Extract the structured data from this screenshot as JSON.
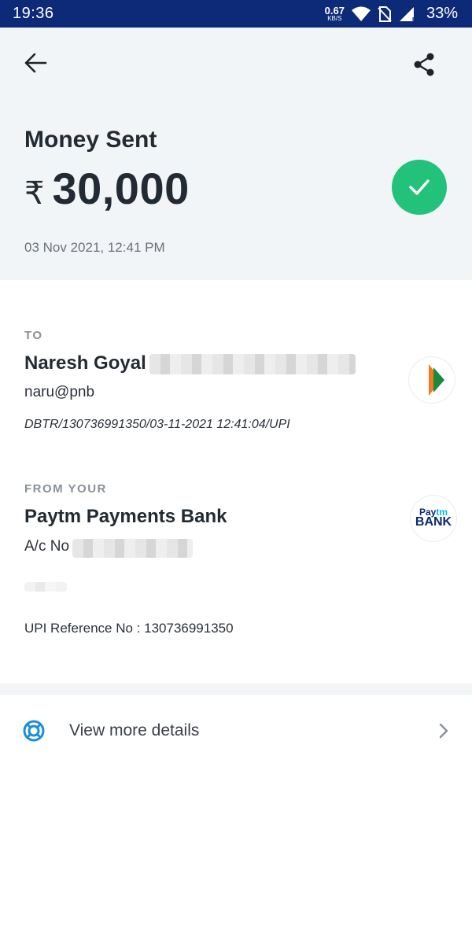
{
  "status_bar": {
    "time": "19:36",
    "net_speed_value": "0.67",
    "net_speed_unit": "KB/S",
    "battery": "33%"
  },
  "header": {
    "title": "Money Sent",
    "currency_symbol": "₹",
    "amount": "30,000",
    "datetime": "03 Nov 2021, 12:41 PM",
    "success_color": "#22c27a"
  },
  "to": {
    "label": "TO",
    "name": "Naresh Goyal",
    "upi_id": "naru@pnb",
    "reference": "DBTR/130736991350/03-11-2021 12:41:04/UPI",
    "bank_logo": "bhim-upi-logo"
  },
  "from": {
    "label": "FROM YOUR",
    "bank_name": "Paytm Payments Bank",
    "account_prefix": "A/c No",
    "upi_reference": "UPI Reference No : 130736991350",
    "logo_line1": "Pay",
    "logo_line1_accent": "tm",
    "logo_line2": "BANK"
  },
  "more": {
    "label": "View more details"
  },
  "colors": {
    "status_bar": "#0d2a78",
    "header_bg": "#f2f5f7",
    "success": "#22c27a"
  }
}
